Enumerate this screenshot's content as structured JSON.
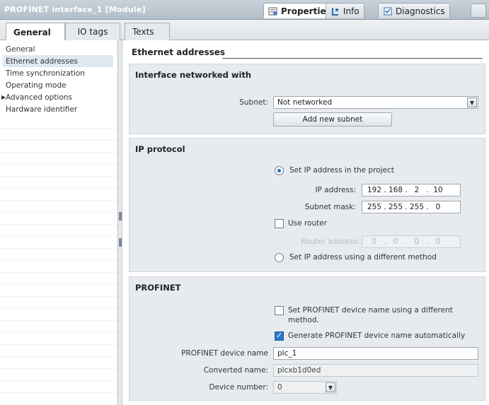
{
  "window": {
    "title": "PROFINET interface_1 [Module]",
    "tabs": [
      {
        "label": "Properties",
        "icon": "properties-icon"
      },
      {
        "label": "Info",
        "icon": "info-icon"
      },
      {
        "label": "Diagnostics",
        "icon": "diagnostics-icon"
      }
    ]
  },
  "page_tabs": [
    "General",
    "IO tags",
    "Texts"
  ],
  "nav": {
    "items": [
      {
        "label": "General"
      },
      {
        "label": "Ethernet addresses"
      },
      {
        "label": "Time synchronization"
      },
      {
        "label": "Operating mode"
      },
      {
        "label": "Advanced options"
      },
      {
        "label": "Hardware identifier"
      }
    ]
  },
  "content": {
    "section_title": "Ethernet addresses",
    "interface": {
      "title": "Interface networked with",
      "subnet_label": "Subnet:",
      "subnet_value": "Not networked",
      "add_button": "Add new subnet"
    },
    "ip": {
      "title": "IP protocol",
      "opt_project": "Set IP address in the project",
      "ip_label": "IP address:",
      "ip": [
        "192",
        "168",
        "2",
        "10"
      ],
      "mask_label": "Subnet mask:",
      "mask": [
        "255",
        "255",
        "255",
        "0"
      ],
      "use_router": "Use router",
      "router_label": "Router address:",
      "router": [
        "0",
        "0",
        "0",
        "0"
      ],
      "opt_other": "Set IP address using a different method"
    },
    "profinet": {
      "title": "PROFINET",
      "opt_diff_1": "Set PROFINET device name using a different",
      "opt_diff_2": "method.",
      "opt_auto": "Generate PROFINET device name automatically",
      "device_name_label": "PROFINET device name",
      "device_name": "plc_1",
      "converted_label": "Converted name:",
      "converted": "plcxb1d0ed",
      "number_label": "Device number:",
      "number": "0"
    }
  },
  "colors": {
    "accent": "#1a6fc8",
    "panel": "#e8ebee",
    "titlebar": "#b3bec8"
  }
}
